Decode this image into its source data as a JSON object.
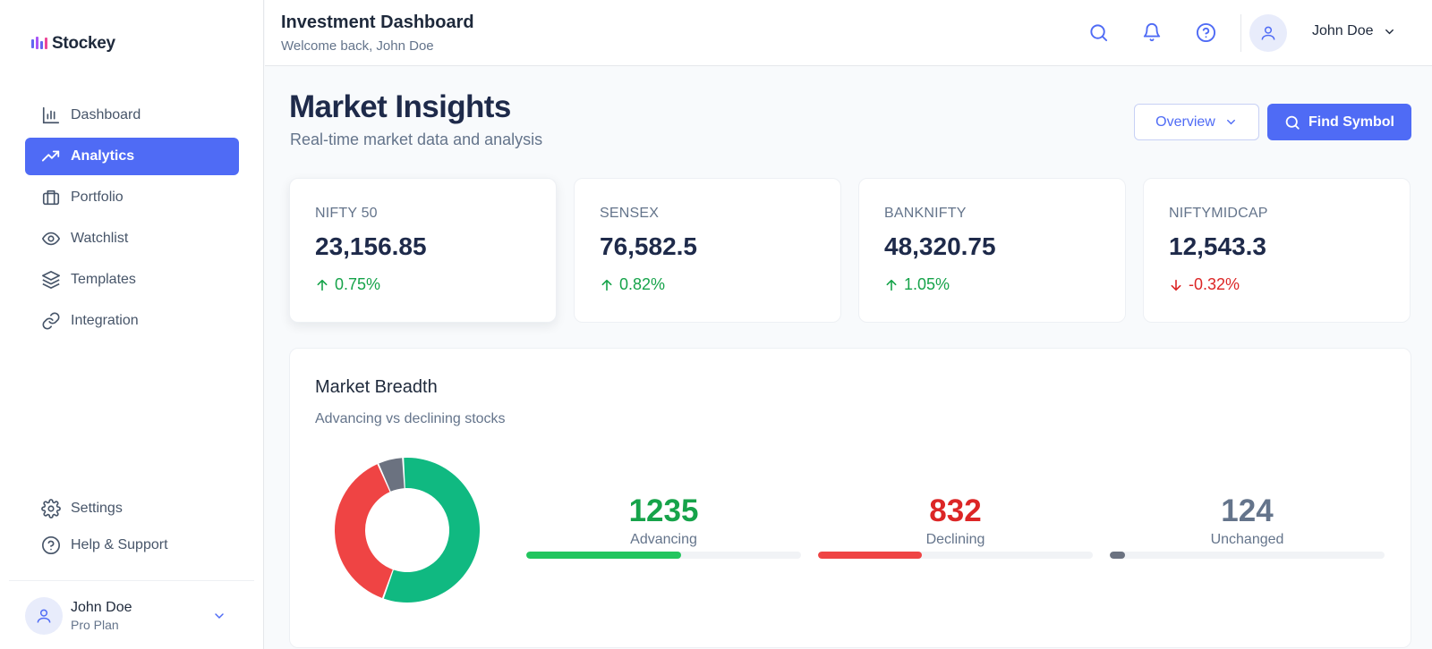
{
  "app": {
    "name": "Stockey"
  },
  "sidebar": {
    "items": [
      {
        "label": "Dashboard",
        "icon": "bar-chart-icon",
        "active": false
      },
      {
        "label": "Analytics",
        "icon": "trending-up-icon",
        "active": true
      },
      {
        "label": "Portfolio",
        "icon": "briefcase-icon",
        "active": false
      },
      {
        "label": "Watchlist",
        "icon": "eye-icon",
        "active": false
      },
      {
        "label": "Templates",
        "icon": "layers-icon",
        "active": false
      },
      {
        "label": "Integration",
        "icon": "link-icon",
        "active": false
      }
    ],
    "bottom_items": [
      {
        "label": "Settings",
        "icon": "gear-icon"
      },
      {
        "label": "Help & Support",
        "icon": "help-circle-icon"
      }
    ],
    "user": {
      "name": "John Doe",
      "plan": "Pro Plan"
    }
  },
  "header": {
    "title": "Investment Dashboard",
    "subtitle": "Welcome back, John Doe",
    "user_name": "John Doe",
    "icons": [
      "search-icon",
      "bell-icon",
      "help-circle-icon"
    ]
  },
  "main": {
    "title": "Market Insights",
    "subtitle": "Real-time market data and analysis",
    "overview_label": "Overview",
    "find_symbol_label": "Find Symbol"
  },
  "indices": [
    {
      "name": "NIFTY 50",
      "value": "23,156.85",
      "change": "0.75%",
      "direction": "up"
    },
    {
      "name": "SENSEX",
      "value": "76,582.5",
      "change": "0.82%",
      "direction": "up"
    },
    {
      "name": "BANKNIFTY",
      "value": "48,320.75",
      "change": "1.05%",
      "direction": "up"
    },
    {
      "name": "NIFTYMIDCAP",
      "value": "12,543.3",
      "change": "-0.32%",
      "direction": "down"
    }
  ],
  "breadth": {
    "title": "Market Breadth",
    "subtitle": "Advancing vs declining stocks",
    "stats": [
      {
        "value": "1235",
        "label": "Advancing",
        "color": "#16a34a",
        "bar_color": "#22c55e",
        "fraction": 0.563
      },
      {
        "value": "832",
        "label": "Declining",
        "color": "#dc2626",
        "bar_color": "#ef4444",
        "fraction": 0.379
      },
      {
        "value": "124",
        "label": "Unchanged",
        "color": "#64748b",
        "bar_color": "#6b7280",
        "fraction": 0.057
      }
    ]
  },
  "chart_data": {
    "type": "pie",
    "categories": [
      "Advancing",
      "Declining",
      "Unchanged"
    ],
    "values": [
      1235,
      832,
      124
    ],
    "colors": [
      "#10b981",
      "#ef4444",
      "#6b7280"
    ],
    "title": "Market Breadth"
  },
  "colors": {
    "accent": "#4f6bf5",
    "up": "#16a34a",
    "down": "#dc2626"
  }
}
